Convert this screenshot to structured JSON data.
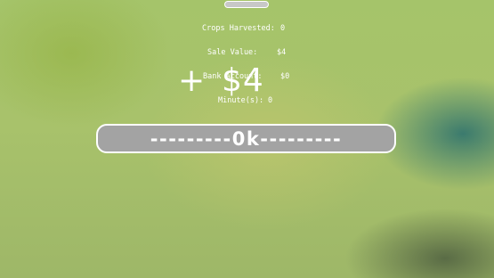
{
  "stats": {
    "crops_harvested_label": "Crops Harvested:",
    "crops_harvested_value": "0",
    "sale_value_label": "Sale Value:",
    "sale_value_value": "$4",
    "bank_account_label": "Bank Account:",
    "bank_account_value": "$0",
    "minutes_label": "Minute(s):",
    "minutes_value": "0"
  },
  "gain": {
    "sign": "+",
    "amount": "$4"
  },
  "ok_button": {
    "label": "---------0k---------"
  },
  "colors": {
    "button_fill": "#a3a3a3",
    "button_border": "#ffffff",
    "text": "#ffffff"
  }
}
